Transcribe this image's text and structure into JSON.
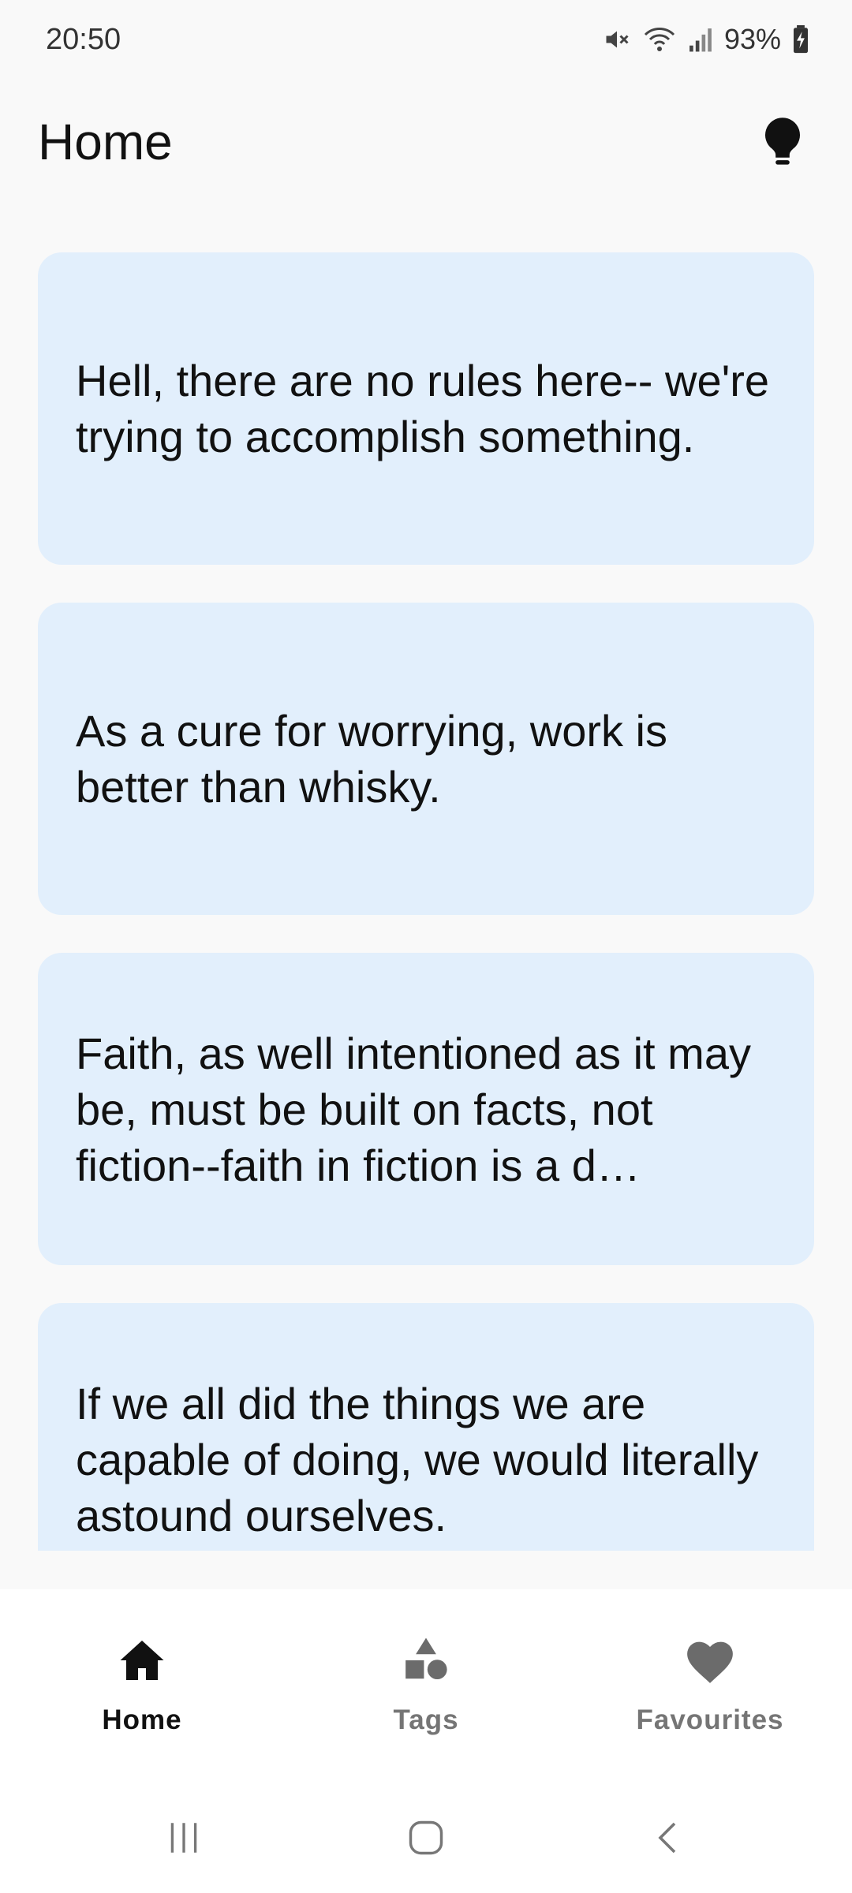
{
  "status_bar": {
    "time": "20:50",
    "battery": "93%",
    "icons": [
      "mute-icon",
      "wifi-icon",
      "signal-icon",
      "battery-icon"
    ]
  },
  "app_bar": {
    "title": "Home",
    "action_icon": "lightbulb-icon"
  },
  "quotes": [
    {
      "text": "Hell, there are no rules here-- we're trying to accomplish something."
    },
    {
      "text": "As a cure for worrying, work is better than whisky."
    },
    {
      "text": "Faith, as well intentioned as it may be, must be built on facts, not fiction--faith in fiction is a d…"
    },
    {
      "text": "If we all did the things we are capable of doing, we would literally astound ourselves."
    }
  ],
  "bottom_nav": {
    "items": [
      {
        "label": "Home",
        "icon": "home-icon",
        "active": true
      },
      {
        "label": "Tags",
        "icon": "shapes-icon",
        "active": false
      },
      {
        "label": "Favourites",
        "icon": "heart-icon",
        "active": false
      }
    ]
  },
  "system_nav": [
    "recents-icon",
    "home-circle-icon",
    "back-icon"
  ],
  "colors": {
    "background": "#f9f9f9",
    "card": "#e2effc",
    "nav_active": "#111111",
    "nav_inactive": "#757575"
  }
}
